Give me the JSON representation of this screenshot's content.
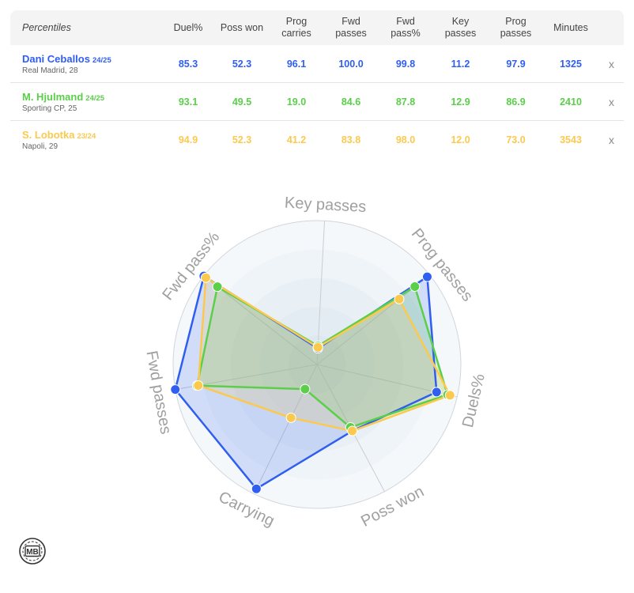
{
  "table": {
    "corner_label": "Percentiles",
    "columns": [
      [
        "Duel%"
      ],
      [
        "Poss won"
      ],
      [
        "Prog",
        "carries"
      ],
      [
        "Fwd",
        "passes"
      ],
      [
        "Fwd",
        "pass%"
      ],
      [
        "Key",
        "passes"
      ],
      [
        "Prog",
        "passes"
      ],
      [
        "Minutes"
      ]
    ],
    "remove_label": "x"
  },
  "players": [
    {
      "name": "Dani Ceballos",
      "season": "24/25",
      "club": "Real Madrid, 28",
      "color": "#2f5ef0",
      "stats": [
        "85.3",
        "52.3",
        "96.1",
        "100.0",
        "99.8",
        "11.2",
        "97.9",
        "1325"
      ]
    },
    {
      "name": "M. Hjulmand",
      "season": "24/25",
      "club": "Sporting CP, 25",
      "color": "#5bce4a",
      "stats": [
        "93.1",
        "49.5",
        "19.0",
        "84.6",
        "87.8",
        "12.9",
        "86.9",
        "2410"
      ]
    },
    {
      "name": "S. Lobotka",
      "season": "23/24",
      "club": "Napoli, 29",
      "color": "#fbc94e",
      "stats": [
        "94.9",
        "52.3",
        "41.2",
        "83.8",
        "98.0",
        "12.0",
        "73.0",
        "3543"
      ]
    }
  ],
  "chart_data": {
    "type": "radar",
    "axes": [
      "Key passes",
      "Prog passes",
      "Duels%",
      "Poss won",
      "Carrying",
      "Fwd passes",
      "Fwd pass%"
    ],
    "range": [
      0,
      100
    ],
    "series": [
      {
        "name": "Dani Ceballos",
        "color": "#2f5ef0",
        "values": [
          11.2,
          97.9,
          85.3,
          52.3,
          96.1,
          100.0,
          99.8
        ]
      },
      {
        "name": "M. Hjulmand",
        "color": "#5bce4a",
        "values": [
          12.9,
          86.9,
          93.1,
          49.5,
          19.0,
          84.6,
          87.8
        ]
      },
      {
        "name": "S. Lobotka",
        "color": "#fbc94e",
        "values": [
          12.0,
          73.0,
          94.9,
          52.3,
          41.2,
          83.8,
          98.0
        ]
      }
    ]
  },
  "logo": {
    "text": "MB"
  }
}
